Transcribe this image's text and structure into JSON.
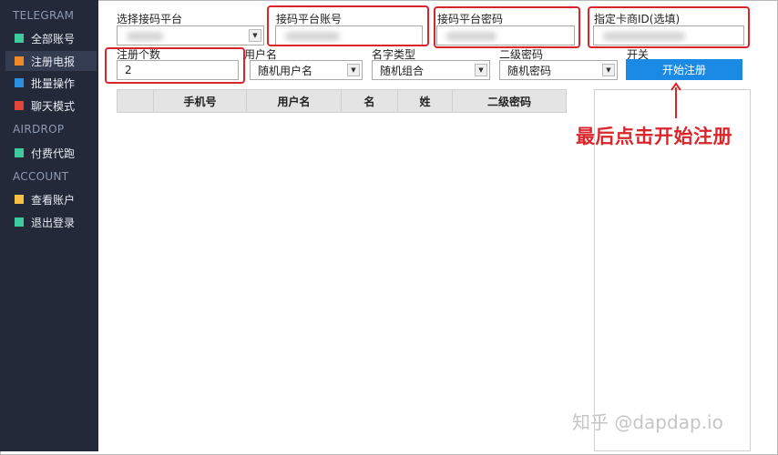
{
  "sidebar": {
    "sections": [
      {
        "title": "TELEGRAM",
        "items": [
          {
            "label": "全部账号",
            "color": "#3fcaa0"
          },
          {
            "label": "注册电报",
            "color": "#f08a24",
            "active": true
          },
          {
            "label": "批量操作",
            "color": "#2b8fe0"
          },
          {
            "label": "聊天模式",
            "color": "#e0463c"
          }
        ]
      },
      {
        "title": "AIRDROP",
        "items": [
          {
            "label": "付费代跑",
            "color": "#3fcaa0"
          }
        ]
      },
      {
        "title": "ACCOUNT",
        "items": [
          {
            "label": "查看账户",
            "color": "#f5c242"
          },
          {
            "label": "退出登录",
            "color": "#3fcaa0"
          }
        ]
      }
    ]
  },
  "form": {
    "platform_label": "选择接码平台",
    "account_label": "接码平台账号",
    "password_label": "接码平台密码",
    "merchant_label": "指定卡商ID(选填)",
    "count_label": "注册个数",
    "count_value": "2",
    "username_label": "用户名",
    "username_value": "随机用户名",
    "nametype_label": "名字类型",
    "nametype_value": "随机组合",
    "twofa_label": "二级密码",
    "twofa_value": "随机密码",
    "switch_label": "开关",
    "start_button": "开始注册"
  },
  "table": {
    "columns": [
      "",
      "手机号",
      "用户名",
      "名",
      "姓",
      "二级密码"
    ]
  },
  "annotation": {
    "text": "最后点击开始注册",
    "color": "#d9262b"
  },
  "watermark": "知乎 @dapdap.io"
}
